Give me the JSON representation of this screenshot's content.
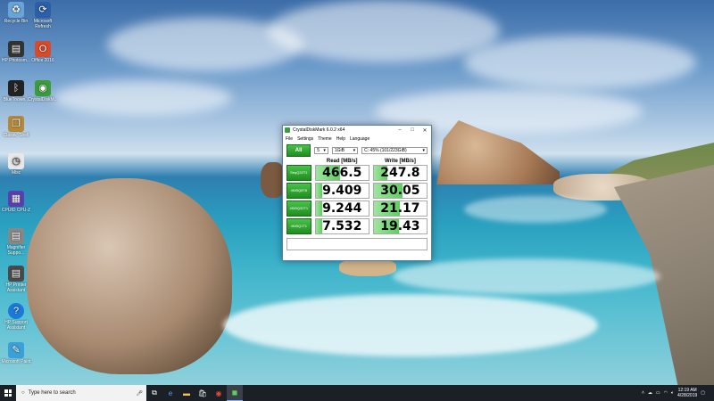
{
  "desktop_icons": [
    {
      "label": "Recycle Bin",
      "icon": "recycle-bin-icon",
      "color": "#6aa3d8"
    },
    {
      "label": "Microsoft Refresh",
      "icon": "refresh-icon",
      "color": "#2b5fa8"
    },
    {
      "label": "HP Photosm...",
      "icon": "printer-icon",
      "color": "#333333"
    },
    {
      "label": "Office 2016",
      "icon": "office-icon",
      "color": "#d94a2b"
    },
    {
      "label": "BlueToowe...",
      "icon": "bluetooth-icon",
      "color": "#222222"
    },
    {
      "label": "CrystalDiskM...",
      "icon": "crystaldiskmark-icon",
      "color": "#3a9c3a"
    },
    {
      "label": "Classic Shell",
      "icon": "shell-icon",
      "color": "#b48a3a"
    },
    {
      "label": "Misc",
      "icon": "clock-icon",
      "color": "#e8e8e8"
    },
    {
      "label": "CPUID CPU-Z",
      "icon": "cpu-icon",
      "color": "#5a3fb0"
    },
    {
      "label": "Magnifier Suppo...",
      "icon": "printer-icon",
      "color": "#888888"
    },
    {
      "label": "HP Printer Assistant",
      "icon": "printer-icon",
      "color": "#4a4a4a"
    },
    {
      "label": "HP Support Assistant",
      "icon": "help-icon",
      "color": "#1a7ad8"
    },
    {
      "label": "Microsoft Paint",
      "icon": "paint-icon",
      "color": "#3aa0d8"
    }
  ],
  "cdm": {
    "title": "CrystalDiskMark 6.0.2 x64",
    "menu": [
      "File",
      "Settings",
      "Theme",
      "Help",
      "Language"
    ],
    "all_label": "All",
    "count": "5",
    "size": "1GiB",
    "drive": "C: 45% (101/223GiB)",
    "read_header": "Read [MB/s]",
    "write_header": "Write [MB/s]",
    "rows": [
      {
        "label1": "Seq",
        "label2": "Q32T1",
        "read": "466.5",
        "write": "247.8",
        "read_fill": 0.47,
        "write_fill": 0.25
      },
      {
        "label1": "4KiB",
        "label2": "Q8T8",
        "read": "9.409",
        "write": "30.05",
        "read_fill": 0.13,
        "write_fill": 0.55
      },
      {
        "label1": "4KiB",
        "label2": "Q32T1",
        "read": "9.244",
        "write": "21.17",
        "read_fill": 0.13,
        "write_fill": 0.5
      },
      {
        "label1": "4KiB",
        "label2": "Q1T1",
        "read": "7.532",
        "write": "19.43",
        "read_fill": 0.12,
        "write_fill": 0.48
      }
    ]
  },
  "taskbar": {
    "search_placeholder": "Type here to search",
    "time": "12:19 AM",
    "date": "4/28/2019"
  }
}
